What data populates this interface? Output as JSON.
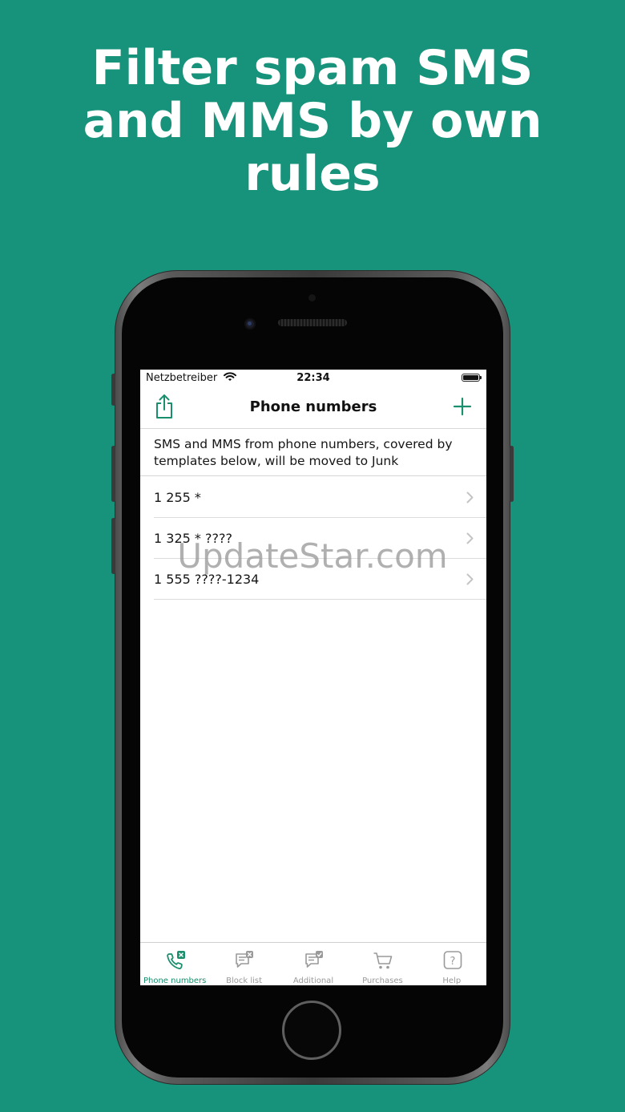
{
  "headline": [
    "Filter spam SMS",
    "and MMS by own",
    "rules"
  ],
  "status_bar": {
    "carrier": "Netzbetreiber",
    "time": "22:34"
  },
  "navbar": {
    "title": "Phone numbers",
    "share_icon": "share-icon",
    "add_icon": "plus-icon"
  },
  "info_text": "SMS and MMS from phone numbers, covered by templates below, will be moved to Junk",
  "rules": [
    {
      "label": "1 255 *"
    },
    {
      "label": "1 325 * ????"
    },
    {
      "label": "1 555 ????-1234"
    }
  ],
  "tabs": [
    {
      "label": "Phone numbers",
      "icon": "phone-block-icon",
      "active": true
    },
    {
      "label": "Block list",
      "icon": "message-block-icon",
      "active": false
    },
    {
      "label": "Additional",
      "icon": "message-check-icon",
      "active": false
    },
    {
      "label": "Purchases",
      "icon": "cart-icon",
      "active": false
    },
    {
      "label": "Help",
      "icon": "help-icon",
      "active": false
    }
  ],
  "watermark": "UpdateStar.com",
  "colors": {
    "background": "#16937a",
    "accent": "#1a8f6d",
    "inactive": "#9a9a9a"
  }
}
